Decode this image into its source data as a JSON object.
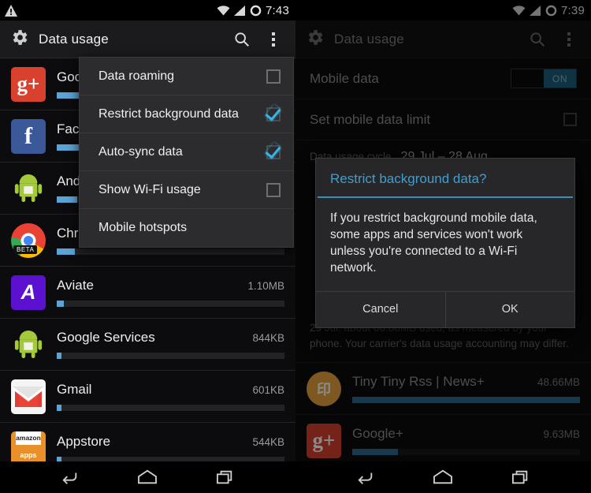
{
  "left": {
    "statusbar": {
      "time": "7:43",
      "icons": [
        "warning-triangle-icon",
        "wifi-icon",
        "signal-bars-icon",
        "no-sim-ring-icon"
      ]
    },
    "actionbar": {
      "title": "Data usage",
      "search": "search-icon",
      "overflow": "overflow-menu-icon"
    },
    "menu": {
      "items": [
        {
          "label": "Data roaming",
          "checked": false
        },
        {
          "label": "Restrict background data",
          "checked": true
        },
        {
          "label": "Auto-sync data",
          "checked": true
        },
        {
          "label": "Show Wi-Fi usage",
          "checked": false
        },
        {
          "label": "Mobile hotspots",
          "checked": null
        }
      ]
    },
    "apps": [
      {
        "name": "Google+",
        "size": "",
        "pct": 62,
        "icon": "gplus-icon"
      },
      {
        "name": "Facebook",
        "size": "",
        "pct": 10,
        "icon": "facebook-icon"
      },
      {
        "name": "Android OS",
        "size": "",
        "pct": 9,
        "icon": "android-icon"
      },
      {
        "name": "Chrome",
        "size": "",
        "pct": 8,
        "icon": "chrome-icon"
      },
      {
        "name": "Aviate",
        "size": "1.10MB",
        "pct": 3,
        "icon": "aviate-icon"
      },
      {
        "name": "Google Services",
        "size": "844KB",
        "pct": 2,
        "icon": "android-icon"
      },
      {
        "name": "Gmail",
        "size": "601KB",
        "pct": 2,
        "icon": "gmail-icon"
      },
      {
        "name": "Appstore",
        "size": "544KB",
        "pct": 2,
        "icon": "amazon-appstore-icon"
      }
    ]
  },
  "right": {
    "statusbar": {
      "time": "7:39",
      "icons": [
        "wifi-icon",
        "signal-bars-icon",
        "no-sim-ring-icon"
      ]
    },
    "actionbar": {
      "title": "Data usage",
      "search": "search-icon",
      "overflow": "overflow-menu-icon"
    },
    "settings": {
      "mobile_data_label": "Mobile data",
      "mobile_data_state": "ON",
      "data_limit_label": "Set mobile data limit",
      "data_limit_checked": false,
      "cycle_label": "Data usage cycle",
      "cycle_value": "29 Jul – 28 Aug"
    },
    "summary": "29 Jul: about 66.88MB used, as measured by your phone. Your carrier's data usage accounting may differ.",
    "apps": [
      {
        "name": "Tiny Tiny Rss | News+",
        "size": "48.66MB",
        "pct": 100,
        "icon": "tiny-tiny-rss-icon"
      },
      {
        "name": "Google+",
        "size": "9.63MB",
        "pct": 20,
        "icon": "gplus-icon"
      }
    ],
    "dialog": {
      "title": "Restrict background data?",
      "message": "If you restrict background mobile data, some apps and services won't work unless you're connected to a Wi-Fi network.",
      "cancel": "Cancel",
      "ok": "OK"
    }
  },
  "navbar": {
    "back": "back-icon",
    "home": "home-icon",
    "recents": "recents-icon"
  },
  "colors": {
    "accent": "#33b5e5",
    "dialog_title": "#3e9fd0",
    "toggle_on": "#1d5f7d",
    "bar": "#5aa4d6"
  }
}
